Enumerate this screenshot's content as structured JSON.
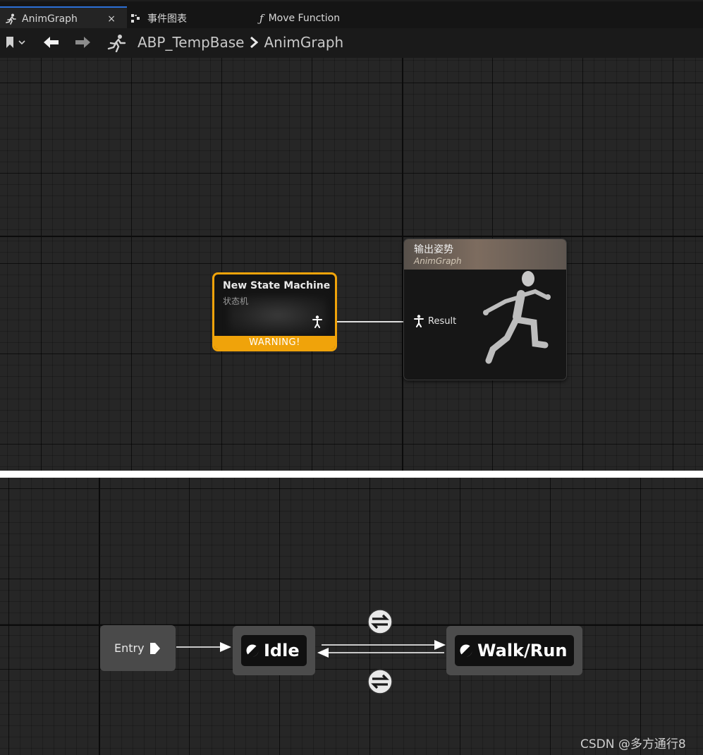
{
  "tabs": [
    {
      "label": "AnimGraph",
      "icon": "running-figure-icon",
      "active": true
    },
    {
      "label": "事件图表",
      "icon": "event-graph-icon",
      "active": false
    },
    {
      "label": "Move Function",
      "icon": "function-icon",
      "active": false
    }
  ],
  "tab_close": "×",
  "breadcrumb": {
    "blueprint": "ABP_TempBase",
    "graph": "AnimGraph"
  },
  "nodes": {
    "state_machine": {
      "title": "New State Machine",
      "subtitle": "状态机",
      "warning": "WARNING!"
    },
    "output_pose": {
      "title": "输出姿势",
      "subtitle": "AnimGraph",
      "pin_label": "Result"
    }
  },
  "state_graph": {
    "entry": "Entry",
    "states": [
      {
        "label": "Idle"
      },
      {
        "label": "Walk/Run"
      }
    ]
  },
  "watermark": "CSDN @多方通行8",
  "colors": {
    "warning": "#f0a30a",
    "active_tab": "#2c6fd6"
  }
}
